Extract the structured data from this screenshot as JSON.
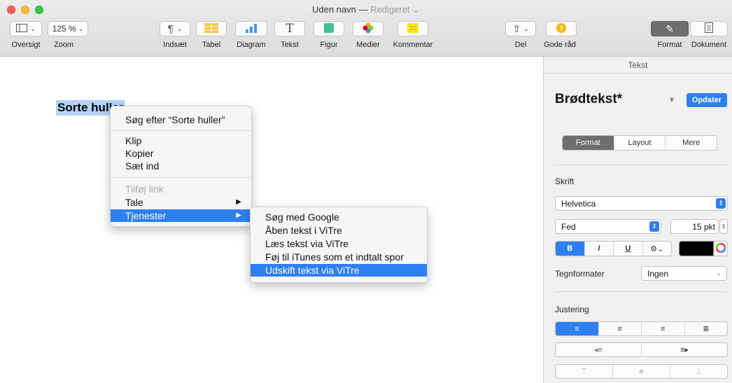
{
  "window": {
    "title": "Uden navn",
    "dash": " — ",
    "edited": "Redigeret"
  },
  "toolbar": {
    "view_label": "Oversigt",
    "zoom_value": "125 %",
    "zoom_label": "Zoom",
    "insert_label": "Indsæt",
    "table_label": "Tabel",
    "chart_label": "Diagram",
    "text_label": "Tekst",
    "shape_label": "Figur",
    "media_label": "Medier",
    "comment_label": "Kommentar",
    "share_label": "Del",
    "tips_label": "Gode råd",
    "format_label": "Format",
    "document_label": "Dokument",
    "icons": [
      "sidebar-view-icon",
      "paragraph-icon",
      "table-icon",
      "chart-icon",
      "text-icon",
      "shape-icon",
      "media-icon",
      "comment-icon",
      "share-icon",
      "tips-icon",
      "format-brush-icon",
      "document-icon"
    ]
  },
  "canvas": {
    "selected_text": "Sorte huller"
  },
  "context_menu": {
    "search": "Søg efter “Sorte huller”",
    "cut": "Klip",
    "copy": "Kopier",
    "paste": "Sæt ind",
    "add_link": "Tilføj link",
    "speech": "Tale",
    "services": "Tjenester"
  },
  "services_menu": {
    "items": [
      "Søg med Google",
      "Åben tekst i ViTre",
      "Læs tekst via ViTre",
      "Føj til iTunes som et indtalt spor",
      "Udskift tekst via ViTre"
    ]
  },
  "sidebar": {
    "header": "Tekst",
    "style_name": "Brødtekst*",
    "update_label": "Opdater",
    "tabs": [
      "Format",
      "Layout",
      "Mere"
    ],
    "font_section": "Skrift",
    "font_family": "Helvetica",
    "font_weight": "Fed",
    "font_size": "15 pkt",
    "bold": "B",
    "italic": "I",
    "underline": "U",
    "char_styles_label": "Tegnformater",
    "char_styles_value": "Ingen",
    "alignment_section": "Justering",
    "text_color": "#000000",
    "accent_color": "#2f7ff1"
  }
}
